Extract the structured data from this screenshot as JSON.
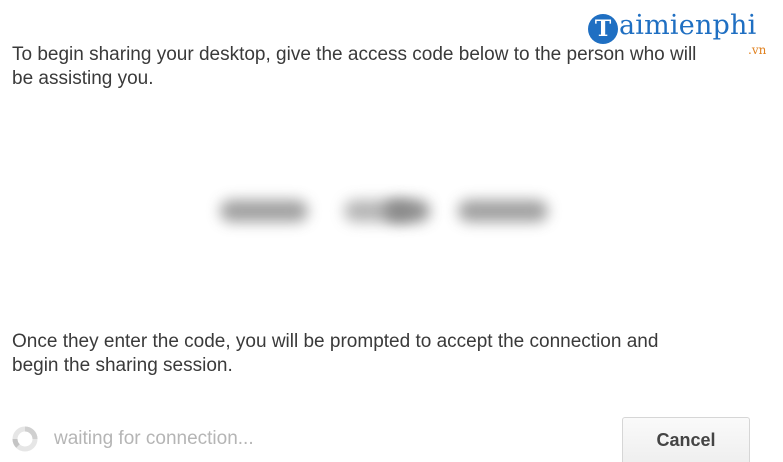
{
  "instruction_text": "To begin sharing your desktop, give the access code below to the person who will be assisting you.",
  "watermark": {
    "badge": "T",
    "name": "aimienphi",
    "tld": ".vn"
  },
  "access_code": {
    "value": "",
    "obscured": true
  },
  "followup_text": "Once they enter the code, you will be prompted to accept the connection and begin the sharing session.",
  "status": {
    "icon": "spinner-icon",
    "text": "waiting for connection..."
  },
  "cancel_label": "Cancel",
  "colors": {
    "watermark_blue": "#1f6fc2",
    "watermark_orange": "#e0811f",
    "status_gray": "#b5b5b5"
  }
}
